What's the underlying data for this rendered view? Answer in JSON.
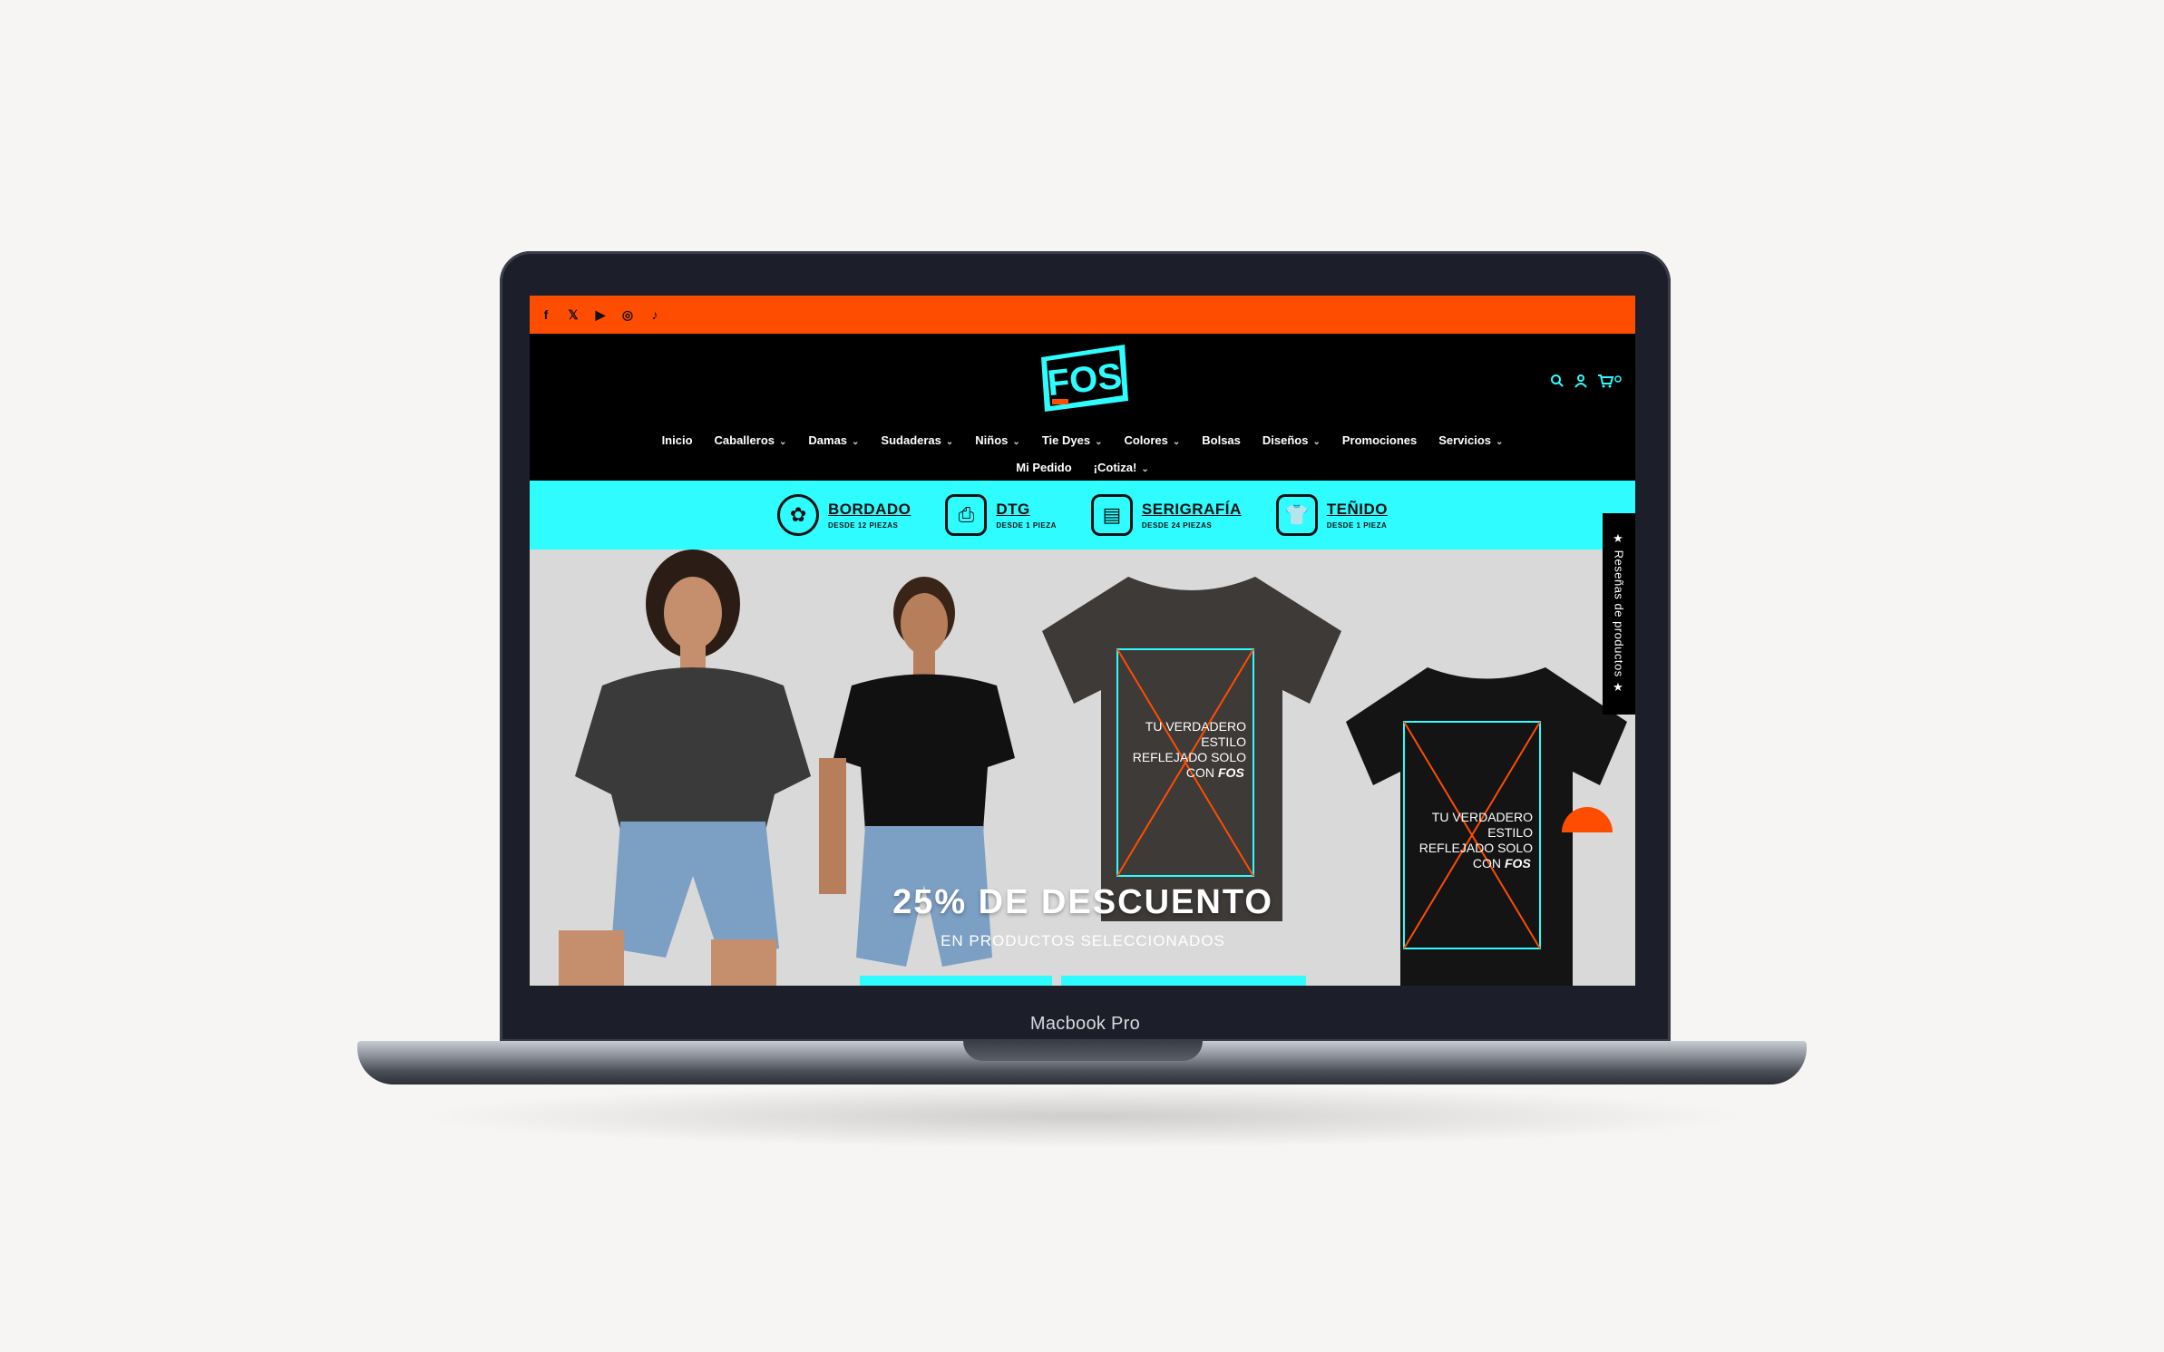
{
  "device": {
    "model_label": "Macbook Pro"
  },
  "colors": {
    "accent_orange": "#ff4d00",
    "accent_cyan": "#2efcff",
    "background": "#000000"
  },
  "topbar": {
    "social_icons": [
      "facebook-icon",
      "x-icon",
      "youtube-icon",
      "instagram-icon",
      "tiktok-icon"
    ],
    "glyphs": [
      "f",
      "𝕏",
      "▶",
      "◎",
      "♪"
    ]
  },
  "header": {
    "logo_text": "FOS",
    "icons": [
      "search-icon",
      "account-icon",
      "cart-icon"
    ]
  },
  "nav": {
    "row1": [
      {
        "label": "Inicio",
        "dropdown": false
      },
      {
        "label": "Caballeros",
        "dropdown": true
      },
      {
        "label": "Damas",
        "dropdown": true
      },
      {
        "label": "Sudaderas",
        "dropdown": true
      },
      {
        "label": "Niños",
        "dropdown": true
      },
      {
        "label": "Tie Dyes",
        "dropdown": true
      },
      {
        "label": "Colores",
        "dropdown": true
      },
      {
        "label": "Bolsas",
        "dropdown": false
      },
      {
        "label": "Diseños",
        "dropdown": true
      },
      {
        "label": "Promociones",
        "dropdown": false
      },
      {
        "label": "Servicios",
        "dropdown": true
      }
    ],
    "row2": [
      {
        "label": "Mi Pedido",
        "dropdown": false
      },
      {
        "label": "¡Cotiza!",
        "dropdown": true
      }
    ]
  },
  "services": [
    {
      "title": "BORDADO",
      "subtitle": "DESDE 12 PIEZAS",
      "icon": "embroidery-icon"
    },
    {
      "title": "DTG",
      "subtitle": "DESDE 1 PIEZA",
      "icon": "dtg-printer-icon"
    },
    {
      "title": "SERIGRAFÍA",
      "subtitle": "DESDE 24 PIEZAS",
      "icon": "screen-print-icon"
    },
    {
      "title": "TEÑIDO",
      "subtitle": "DESDE 1 PIEZA",
      "icon": "tie-dye-icon"
    }
  ],
  "hero": {
    "title": "25% DE DESCUENTO",
    "subtitle": "EN PRODUCTOS SELECCIONADOS",
    "print_text": [
      "TU VERDADERO",
      "ESTILO",
      "REFLEJADO SOLO",
      "CON"
    ],
    "print_brand": "FOS"
  },
  "reviews_tab": {
    "label": "★ Reseñas de productos ★"
  }
}
